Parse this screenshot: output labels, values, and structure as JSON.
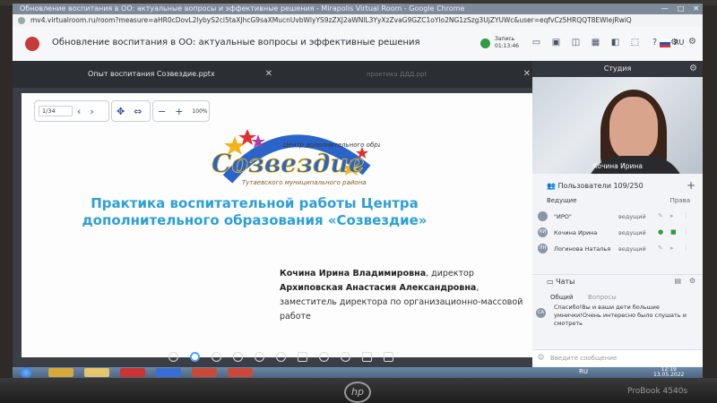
{
  "browser": {
    "window_title": "Обновление воспитания в ОО: актуальные вопросы и эффективные решения - Mirapolis Virtual Room - Google Chrome",
    "url": "mv4.virtualroom.ru/room?measure=aHR0cDovL2lybyS2ci5taXJhcG9saXMucnUvbWlyYS9zZXJ2aWNlL3YyXzZvaG9GZC1oYlo2NG1zSzg3UjZYUWc&user=eqfvCz5HRQQT8EWlejRwiQ"
  },
  "header": {
    "title": "Обновление воспитания в ОО: актуальные вопросы и эффективные решения",
    "record_label": "Запись",
    "record_time": "01:13:46",
    "lang": "RU"
  },
  "tabs": [
    {
      "label": "Опыт воспитания Созвездие.pptx",
      "active": true
    },
    {
      "label": "практика ДДД.ppt",
      "active": false
    }
  ],
  "slide_controls": {
    "page": "1/34",
    "zoom": "100%"
  },
  "slide": {
    "logo_top": "Центр дополнительного образования",
    "logo_main": "Созвездие",
    "logo_bottom": "Тутаевского муниципального района",
    "heading": "Практика воспитательной работы Центра дополнительного образования «Созвездие»",
    "author1_name": "Кочина Ирина Владимировна",
    "author1_role": ", директор",
    "author2_name": "Архиповская Анастасия Александровна",
    "author2_role": ", заместитель директора по организационно-массовой работе"
  },
  "studio": {
    "title": "Студия",
    "speaker": "Кочина Ирина"
  },
  "users": {
    "label": "Пользователи",
    "count": "109/250",
    "group_label": "Ведущие",
    "group_right": "Права",
    "rows": [
      {
        "initials": "",
        "name": "\"ИРО\"",
        "role": "ведущий"
      },
      {
        "initials": "КИ",
        "name": "Кочина Ирина",
        "role": "ведущий"
      },
      {
        "initials": "ЛН",
        "name": "Логинова Наталья",
        "role": "ведущий"
      }
    ]
  },
  "chats": {
    "label": "Чаты",
    "tab_general": "Общий",
    "tab_questions": "Вопросы",
    "message_avatar": "СА",
    "message": "Спасибо!Вы и ваши дети большие умнички!Очень интересно было слушать и смотреть",
    "input_placeholder": "Введите сообщение"
  },
  "taskbar": {
    "lang": "RU",
    "time": "12:19",
    "date": "13.05.2022"
  },
  "laptop": {
    "brand": "hp",
    "model": "ProBook 4540s"
  }
}
